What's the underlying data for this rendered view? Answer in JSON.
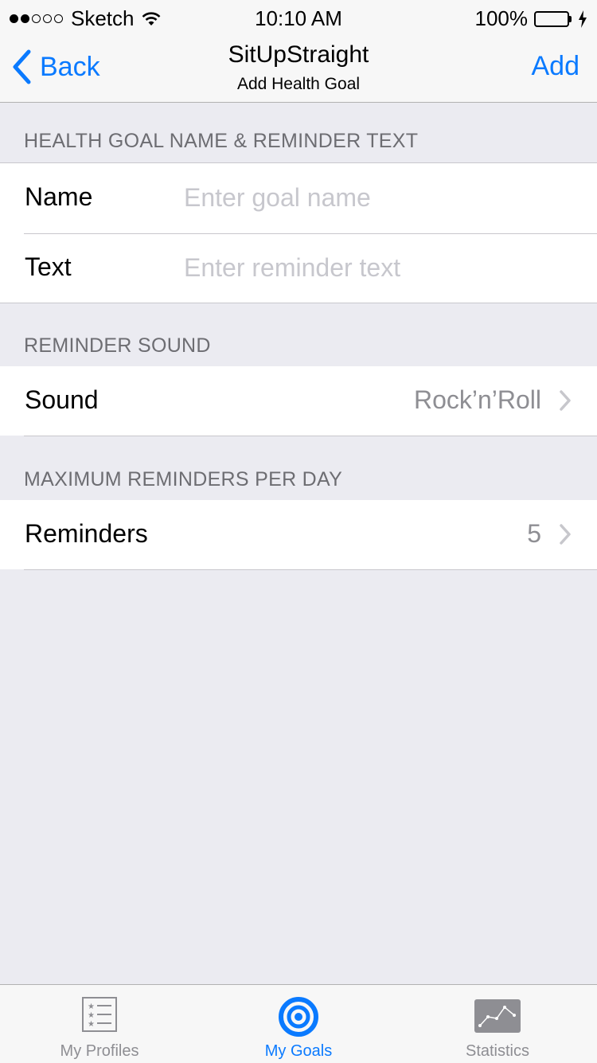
{
  "status_bar": {
    "carrier": "Sketch",
    "time": "10:10 AM",
    "battery": "100%",
    "battery_color": "#4CD964"
  },
  "nav": {
    "back_label": "Back",
    "title": "SitUpStraight",
    "subtitle": "Add Health Goal",
    "add_label": "Add",
    "accent": "#0A7AFF"
  },
  "sections": {
    "name_text": {
      "header": "HEALTH GOAL NAME & REMINDER TEXT",
      "name_label": "Name",
      "name_placeholder": "Enter goal name",
      "text_label": "Text",
      "text_placeholder": "Enter reminder text"
    },
    "sound": {
      "header": "REMINDER SOUND",
      "label": "Sound",
      "value": "Rock’n’Roll"
    },
    "reminders": {
      "header": "MAXIMUM REMINDERS PER DAY",
      "label": "Reminders",
      "value": "5"
    }
  },
  "tabbar": {
    "tabs": [
      {
        "label": "My Profiles",
        "icon": "list-icon",
        "active": false
      },
      {
        "label": "My Goals",
        "icon": "target-icon",
        "active": true
      },
      {
        "label": "Statistics",
        "icon": "chart-icon",
        "active": false
      }
    ]
  }
}
